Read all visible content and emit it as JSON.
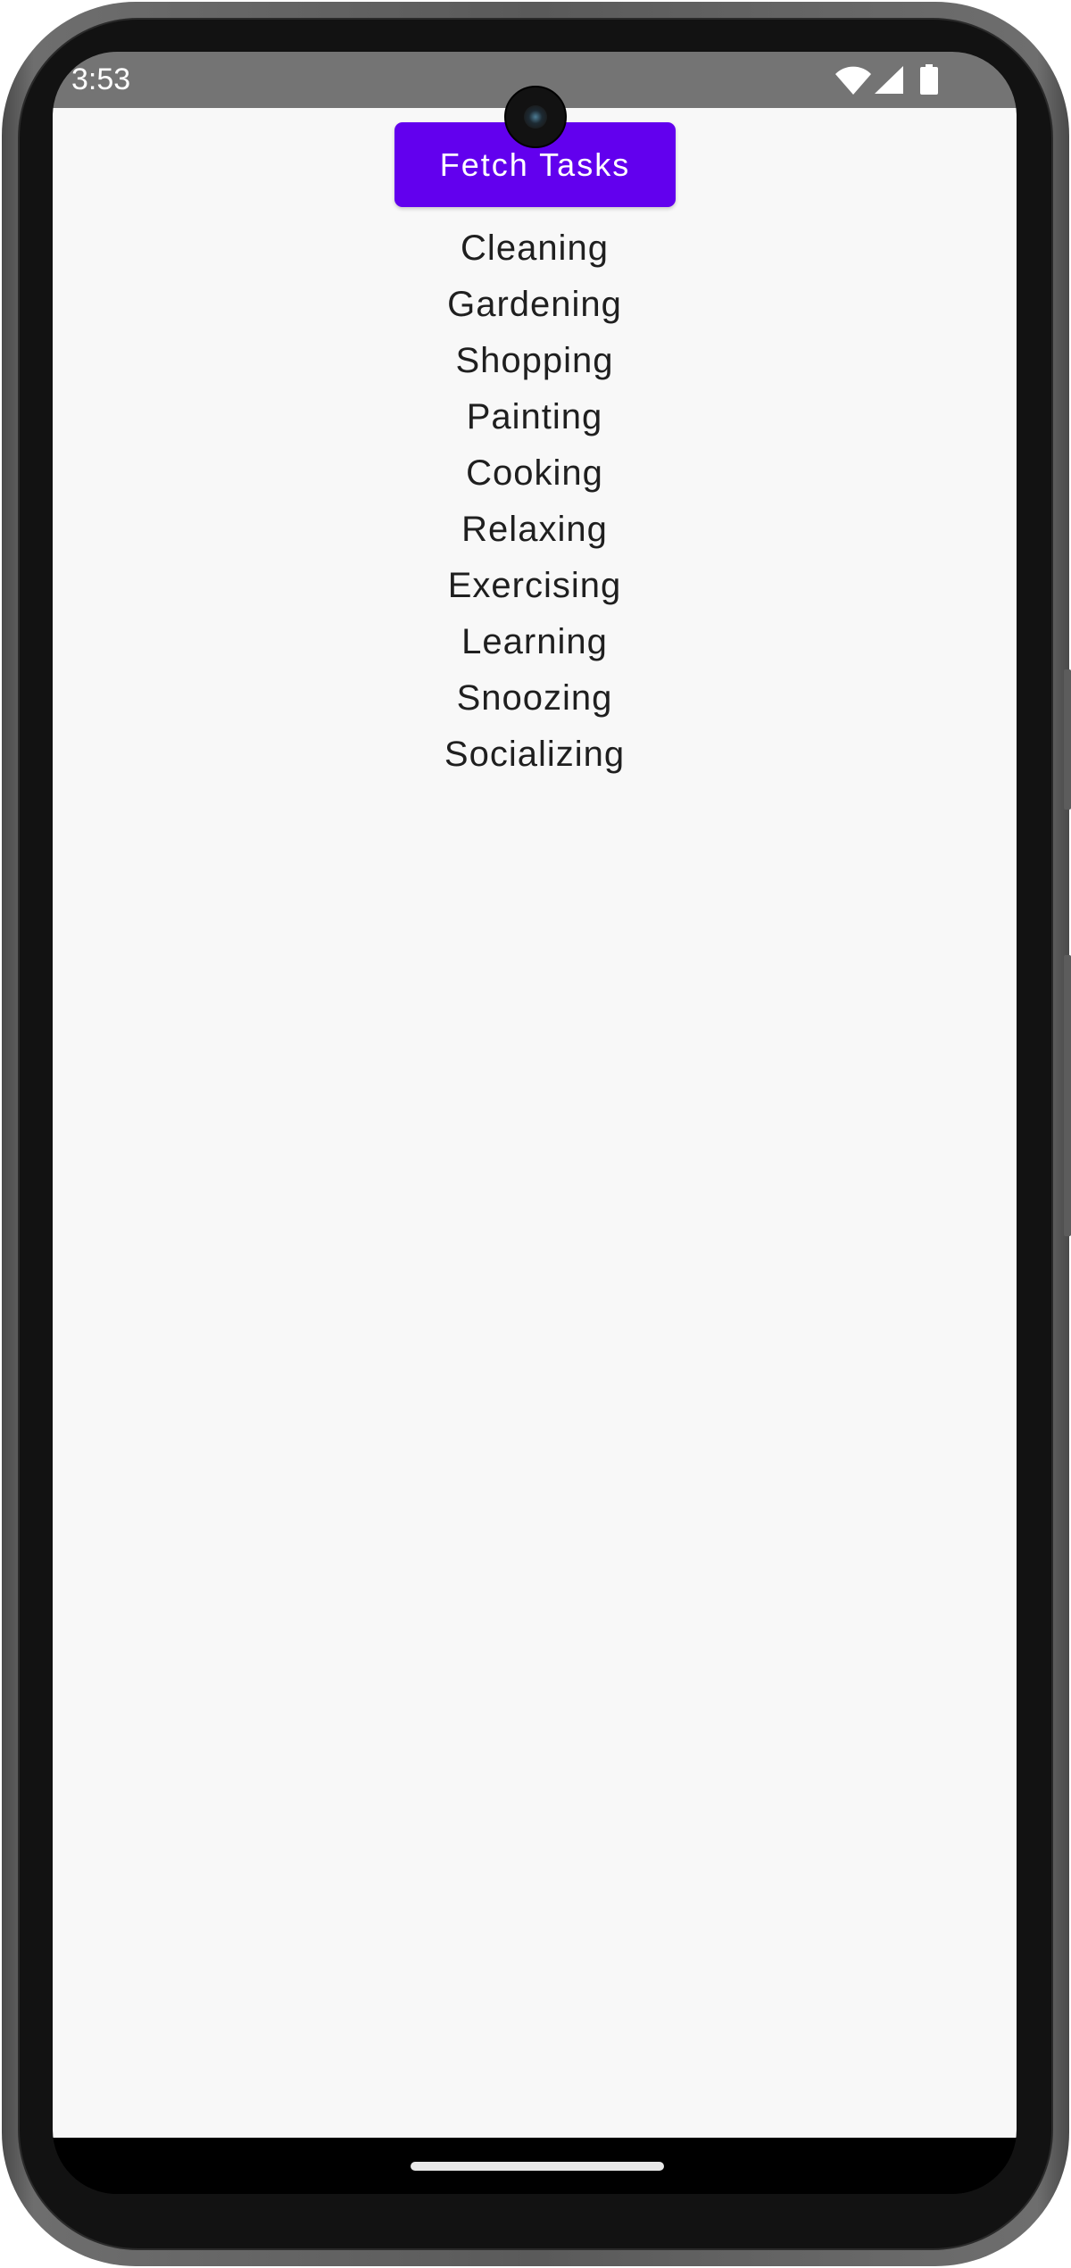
{
  "status_bar": {
    "time": "3:53",
    "icons": [
      "wifi-icon",
      "cellular-signal-icon",
      "battery-icon"
    ]
  },
  "app": {
    "button_label": "Fetch Tasks",
    "accent_color": "#6200ee",
    "tasks": [
      "Cleaning",
      "Gardening",
      "Shopping",
      "Painting",
      "Cooking",
      "Relaxing",
      "Exercising",
      "Learning",
      "Snoozing",
      "Socializing"
    ]
  }
}
